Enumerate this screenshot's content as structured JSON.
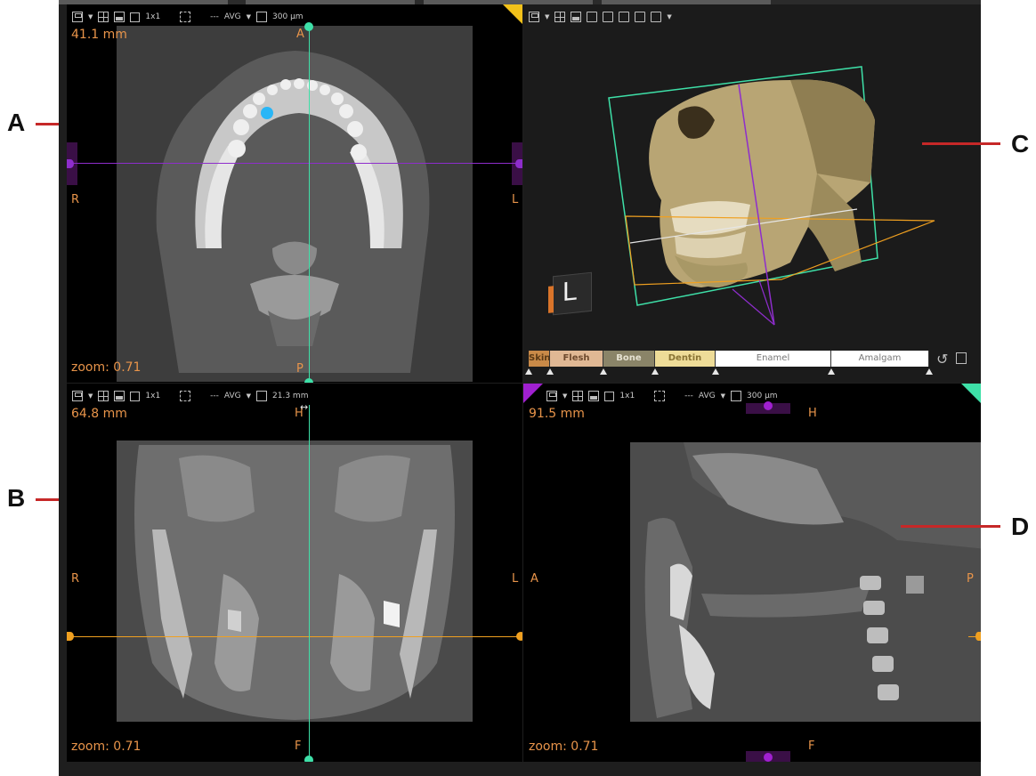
{
  "callouts": {
    "a": "A",
    "b": "B",
    "c": "C",
    "d": "D"
  },
  "toolbar": {
    "layout": "1x1",
    "dash": "---",
    "projection": "AVG",
    "slab_a": "300 µm",
    "slab_b": "21.3 mm",
    "slab_d": "300 µm"
  },
  "view_a": {
    "size": "41.1 mm",
    "top": "A",
    "bottom": "P",
    "left": "R",
    "right": "L",
    "zoom": "zoom: 0.71"
  },
  "view_b": {
    "size": "64.8 mm",
    "top": "H",
    "bottom": "F",
    "left": "R",
    "right": "L",
    "zoom": "zoom: 0.71"
  },
  "view_c": {
    "orientation_label": "L",
    "transfer_function": [
      "Skin",
      "Flesh",
      "Bone",
      "Dentin",
      "Enamel",
      "Amalgam"
    ]
  },
  "view_d": {
    "size": "91.5 mm",
    "top": "H",
    "bottom": "F",
    "left": "A",
    "right": "P",
    "zoom": "zoom: 0.71"
  },
  "icons": [
    "save-icon",
    "fullscreen-icon",
    "snapshot-icon",
    "layout-icon",
    "reslice-icon",
    "slab-icon",
    "cube-icon",
    "reset-icon"
  ],
  "colors": {
    "axial_line": "#8e2dcc",
    "coronal_line": "#f0a020",
    "sagittal_line": "#3ee0a8",
    "label_orange": "#e8944a",
    "callout_red": "#c62828"
  }
}
